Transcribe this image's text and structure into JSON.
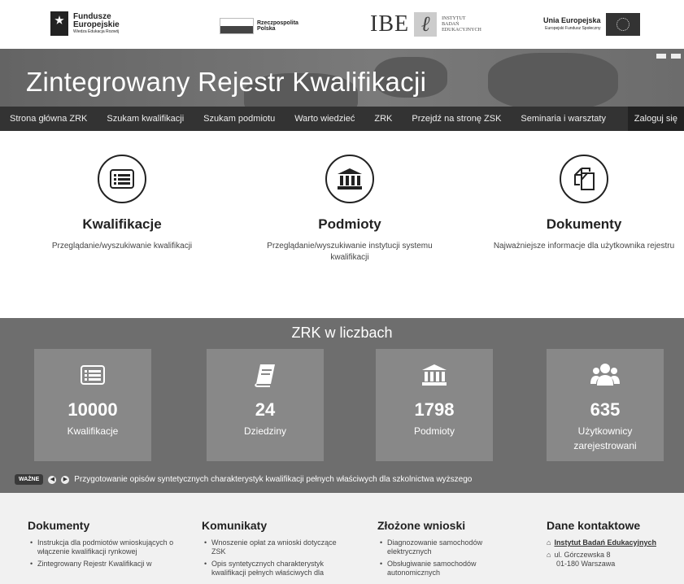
{
  "logos": {
    "fe": {
      "line1": "Fundusze",
      "line2": "Europejskie",
      "line3": "Wiedza Edukacja Rozwój"
    },
    "rp": {
      "line1": "Rzeczpospolita",
      "line2": "Polska"
    },
    "ibe": {
      "abbr": "IBE",
      "line1": "INSTYTUT",
      "line2": "BADAŃ",
      "line3": "EDUKACYJNYCH"
    },
    "ue": {
      "line1": "Unia Europejska",
      "line2": "Europejski Fundusz Społeczny"
    }
  },
  "banner": {
    "title": "Zintegrowany Rejestr Kwalifikacji"
  },
  "nav": [
    "Strona główna ZRK",
    "Szukam kwalifikacji",
    "Szukam podmiotu",
    "Warto wiedzieć",
    "ZRK",
    "Przejdź na stronę ZSK",
    "Seminaria i warsztaty",
    "Zaloguj się"
  ],
  "cards": [
    {
      "title": "Kwalifikacje",
      "desc": "Przeglądanie/wyszukiwanie kwalifikacji",
      "icon": "list-icon"
    },
    {
      "title": "Podmioty",
      "desc": "Przeglądanie/wyszukiwanie instytucji systemu kwalifikacji",
      "icon": "institution-icon"
    },
    {
      "title": "Dokumenty",
      "desc": "Najważniejsze informacje dla użytkownika rejestru",
      "icon": "documents-icon"
    }
  ],
  "stats": {
    "title": "ZRK w liczbach",
    "items": [
      {
        "value": "10000",
        "label": "Kwalifikacje",
        "icon": "list-icon"
      },
      {
        "value": "24",
        "label": "Dziedziny",
        "icon": "book-icon"
      },
      {
        "value": "1798",
        "label": "Podmioty",
        "icon": "institution-icon"
      },
      {
        "value": "635",
        "label": "Użytkownicy zarejestrowani",
        "icon": "users-icon"
      }
    ],
    "ticker": {
      "badge": "WAŻNE",
      "text": "Przygotowanie opisów syntetycznych charakterystyk kwalifikacji pełnych właściwych dla szkolnictwa wyższego"
    }
  },
  "footer": {
    "dokumenty": {
      "title": "Dokumenty",
      "items": [
        "Instrukcja dla podmiotów wnioskujących o włączenie kwalifikacji rynkowej",
        "Zintegrowany Rejestr Kwalifikacji w"
      ]
    },
    "komunikaty": {
      "title": "Komunikaty",
      "items": [
        "Wnoszenie opłat za wnioski dotyczące ZSK",
        "Opis syntetycznych charakterystyk kwalifikacji pełnych właściwych dla"
      ]
    },
    "wnioski": {
      "title": "Złożone wnioski",
      "items": [
        "Diagnozowanie samochodów elektrycznych",
        "Obsługiwanie samochodów autonomicznych"
      ]
    },
    "kontakt": {
      "title": "Dane kontaktowe",
      "org": "Instytut Badań Edukacyjnych",
      "street": "ul. Górczewska 8",
      "city": "01-180 Warszawa"
    }
  }
}
